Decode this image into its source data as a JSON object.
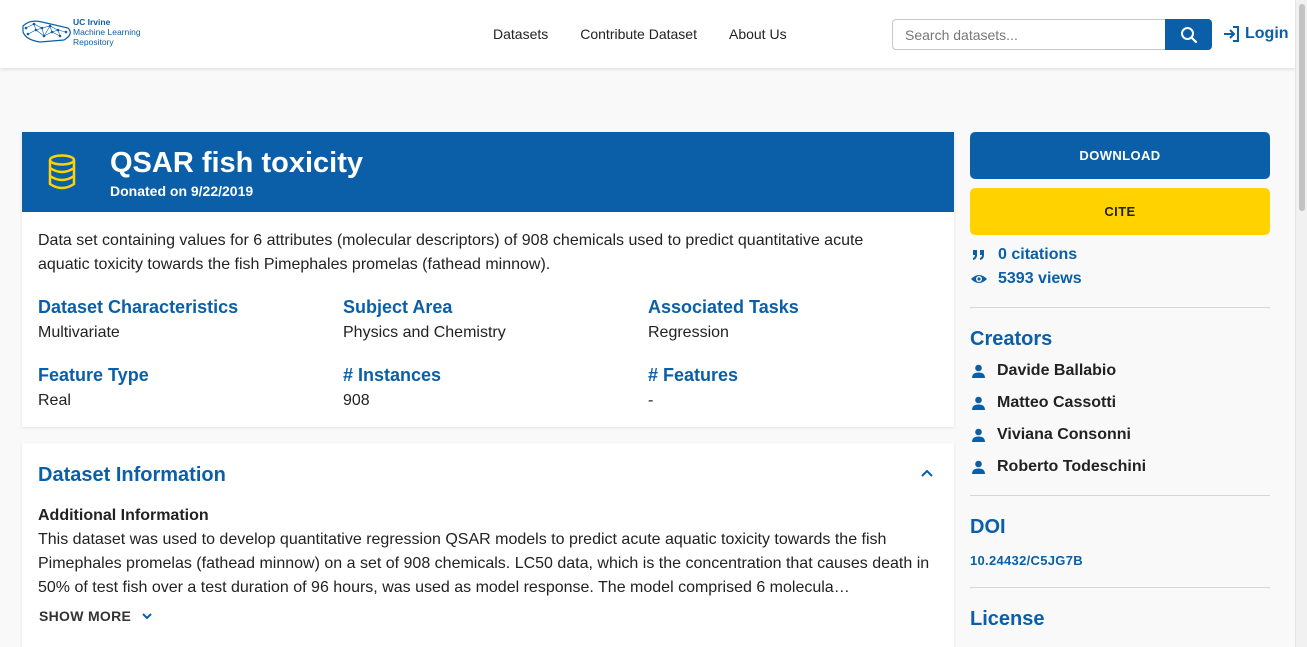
{
  "header": {
    "logo": {
      "line1": "UC Irvine",
      "line2": "Machine Learning",
      "line3": "Repository"
    },
    "nav": [
      "Datasets",
      "Contribute Dataset",
      "About Us"
    ],
    "search_placeholder": "Search datasets...",
    "login_label": "Login"
  },
  "dataset": {
    "title": "QSAR fish toxicity",
    "donated": "Donated on 9/22/2019",
    "description": "Data set containing values for 6 attributes (molecular descriptors) of 908 chemicals used to predict quantitative acute aquatic toxicity towards the fish Pimephales promelas (fathead minnow).",
    "characteristics": [
      {
        "label": "Dataset Characteristics",
        "value": "Multivariate"
      },
      {
        "label": "Subject Area",
        "value": "Physics and Chemistry"
      },
      {
        "label": "Associated Tasks",
        "value": "Regression"
      },
      {
        "label": "Feature Type",
        "value": "Real"
      },
      {
        "label": "# Instances",
        "value": "908"
      },
      {
        "label": "# Features",
        "value": "-"
      }
    ]
  },
  "info": {
    "title": "Dataset Information",
    "subtitle": "Additional Information",
    "text": "This dataset was used to develop quantitative regression QSAR models to predict acute aquatic toxicity towards the fish Pimephales promelas (fathead minnow) on a set of 908 chemicals. LC50 data, which is the concentration that causes death in 50% of test fish over a test duration of 96 hours, was used as model response. The model comprised 6 molecula…",
    "show_more": "SHOW MORE"
  },
  "sidebar": {
    "download_label": "DOWNLOAD",
    "cite_label": "CITE",
    "citations": "0 citations",
    "views": "5393 views",
    "creators_title": "Creators",
    "creators": [
      "Davide Ballabio",
      "Matteo Cassotti",
      "Viviana Consonni",
      "Roberto Todeschini"
    ],
    "doi_title": "DOI",
    "doi": "10.24432/C5JG7B",
    "license_title": "License"
  },
  "colors": {
    "primary": "#0a5fa8",
    "accent": "#ffd200",
    "background": "#f9f9f9"
  }
}
